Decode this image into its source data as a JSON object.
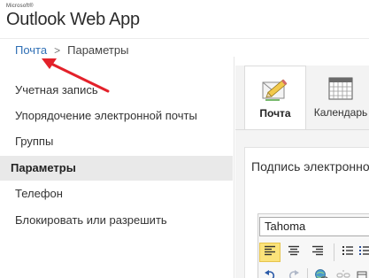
{
  "brand": {
    "small": "Microsoft®",
    "title": "Outlook Web App"
  },
  "breadcrumb": {
    "link": "Почта",
    "separator": ">",
    "current": "Параметры"
  },
  "sidebar": {
    "items": [
      {
        "label": "Учетная запись",
        "active": false
      },
      {
        "label": "Упорядочение электронной почты",
        "active": false
      },
      {
        "label": "Группы",
        "active": false
      },
      {
        "label": "Параметры",
        "active": true
      },
      {
        "label": "Телефон",
        "active": false
      },
      {
        "label": "Блокировать или разрешить",
        "active": false
      }
    ]
  },
  "tabs": [
    {
      "label": "Почта",
      "icon": "mail-pencil-icon",
      "selected": true
    },
    {
      "label": "Календарь",
      "icon": "calendar-icon",
      "selected": false
    }
  ],
  "signature": {
    "title": "Подпись электронной почты"
  },
  "editor": {
    "font": "Tahoma",
    "toolbar_row1": [
      "align-left-icon",
      "align-center-icon",
      "align-right-icon",
      "bulleted-list-icon"
    ],
    "toolbar_row2": [
      "undo-icon",
      "redo-icon",
      "insert-link-icon",
      "remove-link-icon",
      "more-icon"
    ]
  },
  "colors": {
    "link": "#2f6fb5",
    "annotation_arrow": "#e3212a",
    "selected_button": "#fbe37a",
    "active_nav": "#e9e9e9"
  }
}
